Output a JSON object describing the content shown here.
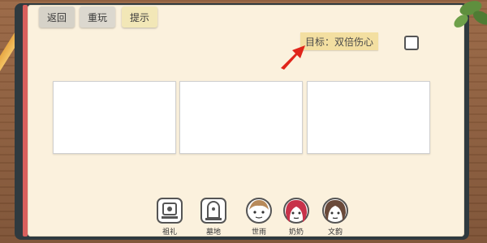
{
  "top_bar": {
    "back_label": "返回",
    "replay_label": "重玩",
    "hint_label": "提示"
  },
  "goal": {
    "label": "目标：双倍伤心"
  },
  "tokens": [
    {
      "label": "祖礼"
    },
    {
      "label": "墓地"
    },
    {
      "label": "世雨"
    },
    {
      "label": "奶奶"
    },
    {
      "label": "文韵"
    }
  ],
  "colors": {
    "page": "#fbf1dd",
    "goal_note": "#f3dfa1",
    "hint_note": "#f2e7b7",
    "arrow": "#e0251b",
    "page_edge": "#d9605d"
  }
}
